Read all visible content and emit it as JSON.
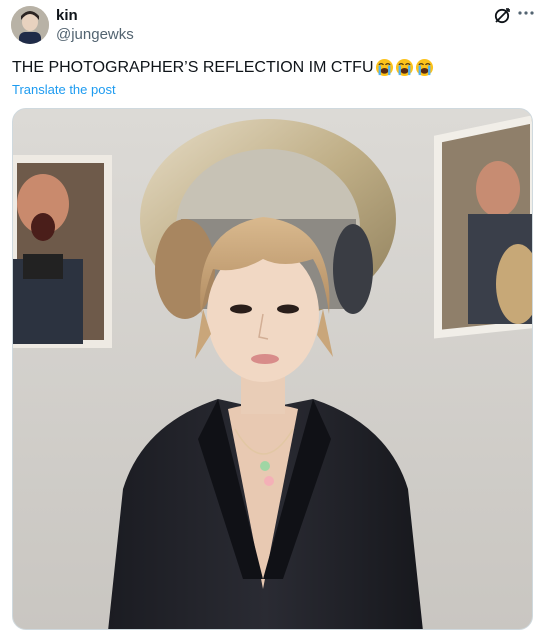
{
  "author": {
    "display_name": "kin",
    "handle": "@jungewks"
  },
  "post": {
    "text": "THE PHOTOGRAPHER’S REFLECTION IM CTFU",
    "emojis": [
      "loudly-crying-face",
      "loudly-crying-face",
      "loudly-crying-face"
    ],
    "translate_label": "Translate the post"
  },
  "icons": {
    "grok": "grok-icon",
    "more": "more-options-icon"
  },
  "colors": {
    "link": "#1d9bf0",
    "secondary_text": "#536471",
    "primary_text": "#0f1419"
  }
}
